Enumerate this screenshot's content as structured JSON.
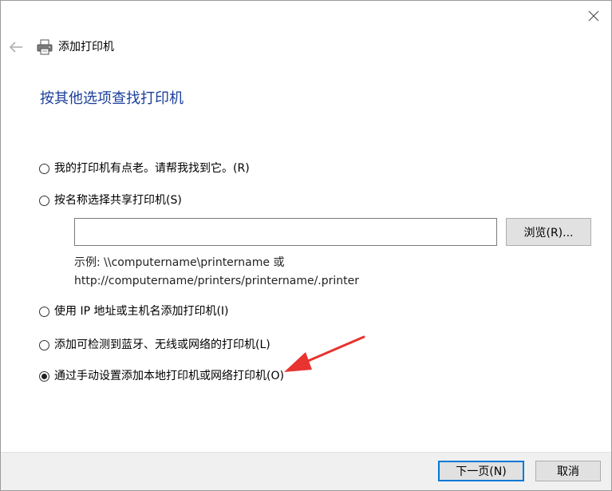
{
  "window": {
    "title": "添加打印机"
  },
  "heading": "按其他选项查找打印机",
  "options": [
    {
      "label": "我的打印机有点老。请帮我找到它。(R)",
      "checked": false
    },
    {
      "label": "按名称选择共享打印机(S)",
      "checked": false
    },
    {
      "label": "使用 IP 地址或主机名添加打印机(I)",
      "checked": false
    },
    {
      "label": "添加可检测到蓝牙、无线或网络的打印机(L)",
      "checked": false
    },
    {
      "label": "通过手动设置添加本地打印机或网络打印机(O)",
      "checked": true
    }
  ],
  "share": {
    "input_value": "",
    "browse_label": "浏览(R)...",
    "example_line1": "示例: \\\\computername\\printername 或",
    "example_line2": "http://computername/printers/printername/.printer"
  },
  "footer": {
    "next_label": "下一页(N)",
    "cancel_label": "取消"
  },
  "colors": {
    "heading": "#1a3e9a",
    "annotation_arrow": "#e8332f",
    "primary_border": "#0078d7"
  },
  "icons": {
    "close": "close-icon",
    "back": "back-arrow-icon",
    "printer": "printer-icon"
  }
}
